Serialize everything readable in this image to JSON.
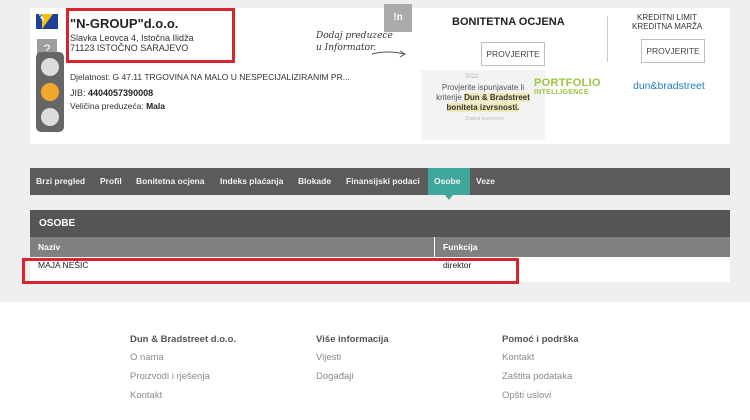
{
  "company": {
    "name": "\"N-GROUP\"d.o.o.",
    "address_line1": "Slavka Leovca 4, Istočna Ilidža",
    "address_line2": "71123 ISTOČNO SARAJEVO",
    "activity": "Djelatnost: G 47.11 TRGOVINA NA MALO U NESPECIJALIZIRANIM PR...",
    "jib_label": "JIB: ",
    "jib_value": "4404057390008",
    "size_label": "Veličina preduzeća: ",
    "size_value": "Mala",
    "flag_icon": "bosnia-flag-icon",
    "traffic_light_state": "yellow",
    "help_symbol": "?"
  },
  "informator": {
    "note_line1": "Dodaj preduzeće",
    "note_line2": "u Informator.",
    "logo_text": "!n"
  },
  "rating": {
    "title": "BONITETNA OCJENA",
    "button": "PROVJERITE"
  },
  "credit_limit": {
    "title_line1": "KREDITNI LIMIT",
    "title_line2": "KREDITNA MARŽA",
    "button": "PROVJERITE"
  },
  "promo": {
    "year": "2022",
    "text_line1": "Provjerite ispunjavate li",
    "text_line2_pre": "kriterije ",
    "text_line2_bold": "Dun & Bradstreet",
    "text_line3_bold": "boniteta izvrsnosti.",
    "sub": "Zlatna izvrsnost",
    "portfolio_line1": "PORTFOLIO",
    "portfolio_line2": "INTELLIGENCE",
    "dnb_logo": "dun&bradstreet"
  },
  "nav": {
    "tabs": [
      {
        "label": "Brzi pregled"
      },
      {
        "label": "Profil"
      },
      {
        "label": "Bonitetna ocjena"
      },
      {
        "label": "Indeks plaćanja"
      },
      {
        "label": "Blokade"
      },
      {
        "label": "Finansijski podaci"
      },
      {
        "label": "Osobe"
      },
      {
        "label": "Veze"
      }
    ],
    "active": "Osobe"
  },
  "persons": {
    "title": "OSOBE",
    "columns": [
      "Naziv",
      "Funkcija"
    ],
    "rows": [
      {
        "name": "MAJA NEŠIĆ",
        "function": "direktor"
      }
    ]
  },
  "footer": {
    "col1": {
      "title": "Dun & Bradstreet d.o.o.",
      "links": [
        "O nama",
        "Proizvodi i rješenja",
        "Kontakt"
      ]
    },
    "col2": {
      "title": "Više informacija",
      "links": [
        "Vijesti",
        "Događaji"
      ]
    },
    "col3": {
      "title": "Pomoć i podrška",
      "links": [
        "Kontakt",
        "Zaštita podataka",
        "Opšti uslovi"
      ]
    }
  },
  "colors": {
    "highlight_border": "#d9232d",
    "active_tab": "#3fa79c",
    "nav_bg": "#5b5b5b",
    "portfolio_green": "#9bc53d",
    "dnb_blue": "#1f7fc1"
  }
}
